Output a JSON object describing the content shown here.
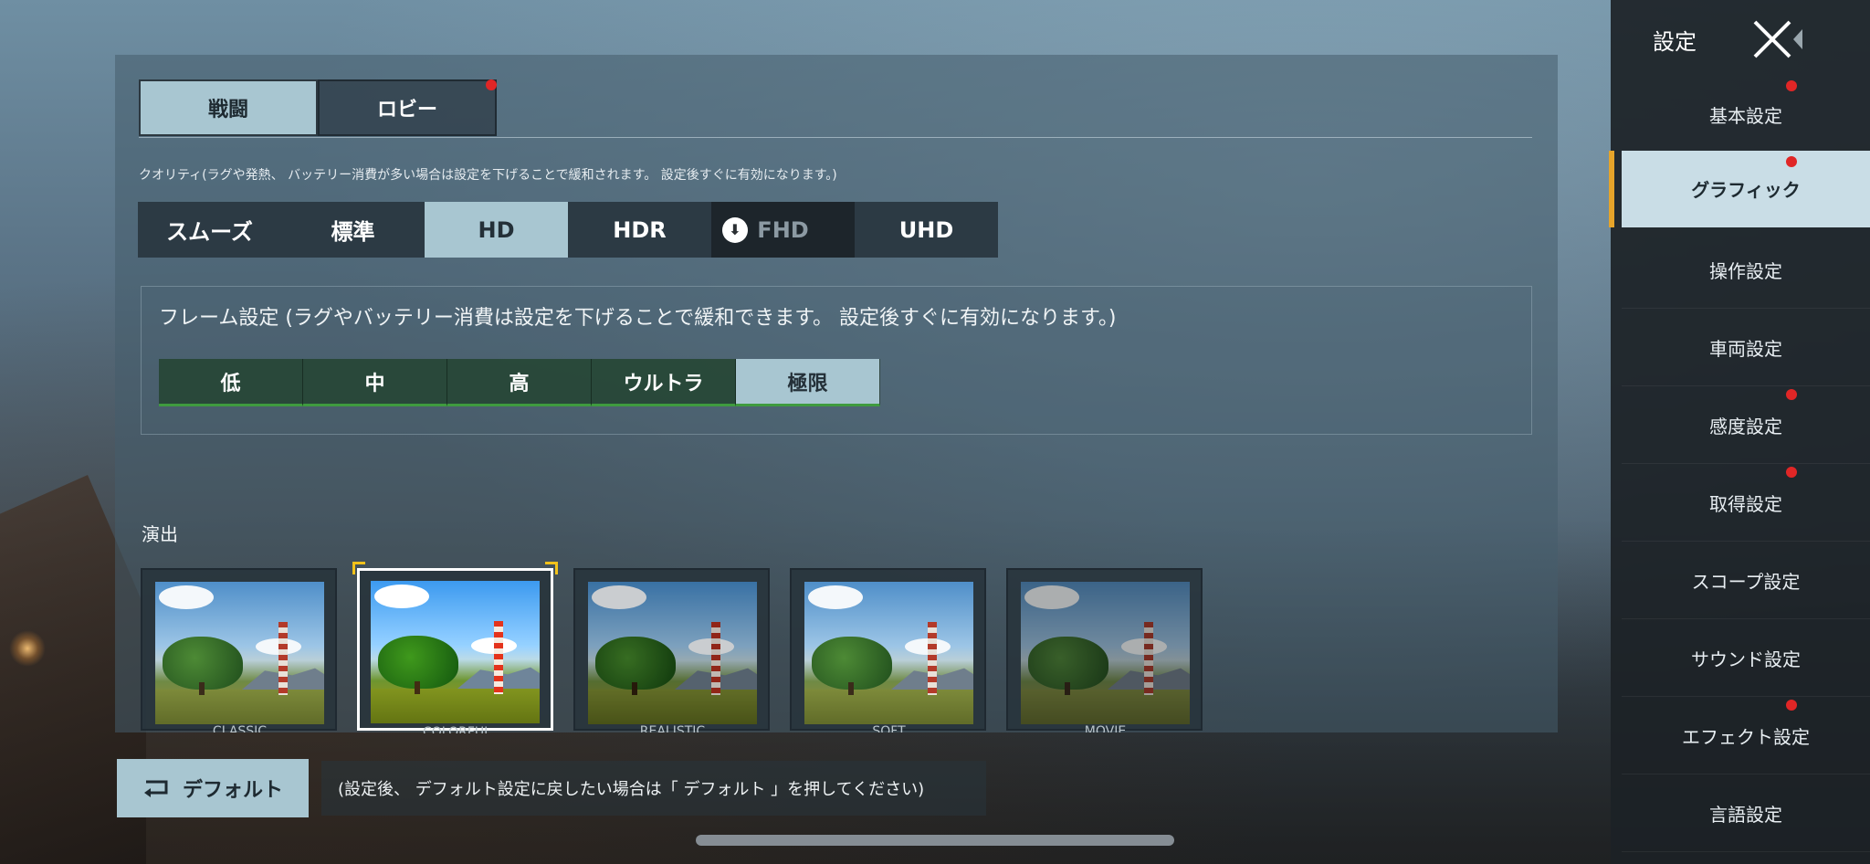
{
  "tabs": [
    {
      "label": "戦闘",
      "active": true,
      "badge": false
    },
    {
      "label": "ロビー",
      "active": false,
      "badge": true
    }
  ],
  "quality": {
    "note": "クオリティ(ラグや発熱、 バッテリー消費が多い場合は設定を下げることで緩和されます。 設定後すぐに有効になります。)",
    "options": [
      {
        "label": "スムーズ",
        "state": "normal"
      },
      {
        "label": "標準",
        "state": "normal"
      },
      {
        "label": "HD",
        "state": "active"
      },
      {
        "label": "HDR",
        "state": "normal"
      },
      {
        "label": "FHD",
        "state": "disabled",
        "icon": "download-icon"
      },
      {
        "label": "UHD",
        "state": "normal"
      }
    ]
  },
  "frame": {
    "note": "フレーム設定 (ラグやバッテリー消費は設定を下げることで緩和できます。 設定後すぐに有効になります。)",
    "options": [
      {
        "label": "低",
        "active": false
      },
      {
        "label": "中",
        "active": false
      },
      {
        "label": "高",
        "active": false
      },
      {
        "label": "ウルトラ",
        "active": false
      },
      {
        "label": "極限",
        "active": true
      }
    ]
  },
  "effects": {
    "label": "演出",
    "cards": [
      {
        "label": "CLASSIC",
        "selected": false,
        "style": "normal"
      },
      {
        "label": "COLORFUL",
        "selected": true,
        "style": "vivid"
      },
      {
        "label": "REALISTIC",
        "selected": false,
        "style": "dim"
      },
      {
        "label": "SOFT",
        "selected": false,
        "style": "normal"
      },
      {
        "label": "MOVIE",
        "selected": false,
        "style": "dark"
      }
    ]
  },
  "default_button": {
    "label": "デフォルト",
    "icon": "reset-icon"
  },
  "default_note": "(設定後、 デフォルト設定に戻したい場合は「 デフォルト 」を押してください)",
  "sidebar": {
    "title": "設定",
    "close_icon": "close-icon",
    "items": [
      {
        "label": "基本設定",
        "active": false,
        "badge": true
      },
      {
        "label": "グラフィック",
        "active": true,
        "badge": true
      },
      {
        "label": "操作設定",
        "active": false,
        "badge": false
      },
      {
        "label": "車両設定",
        "active": false,
        "badge": false
      },
      {
        "label": "感度設定",
        "active": false,
        "badge": true
      },
      {
        "label": "取得設定",
        "active": false,
        "badge": true
      },
      {
        "label": "スコープ設定",
        "active": false,
        "badge": false
      },
      {
        "label": "サウンド設定",
        "active": false,
        "badge": false
      },
      {
        "label": "エフェクト設定",
        "active": false,
        "badge": true
      },
      {
        "label": "言語設定",
        "active": false,
        "badge": false
      }
    ]
  },
  "colors": {
    "active_button": "#a8c6d1",
    "badge": "#e02626",
    "frame_underline": "#3f9b3f",
    "sidebar_accent": "#e6a42a",
    "selection_corner": "#f2c21b"
  }
}
